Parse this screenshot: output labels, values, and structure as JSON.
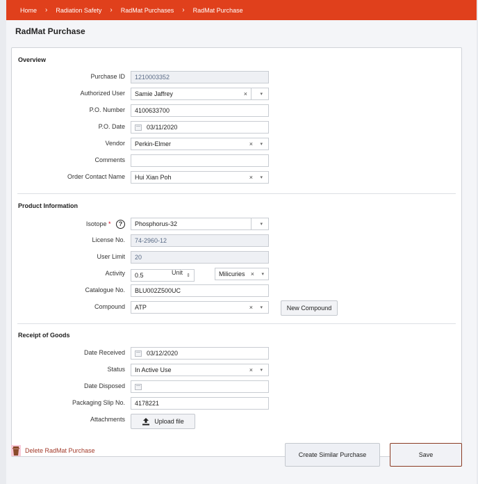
{
  "breadcrumb": [
    "Home",
    "Radiation Safety",
    "RadMat Purchases",
    "RadMat Purchase"
  ],
  "page_title": "RadMat Purchase",
  "overview": {
    "title": "Overview",
    "purchase_id_label": "Purchase ID",
    "purchase_id": "1210003352",
    "authorized_user_label": "Authorized User",
    "authorized_user": "Samie Jaffrey",
    "po_number_label": "P.O. Number",
    "po_number": "4100633700",
    "po_date_label": "P.O. Date",
    "po_date": "03/11/2020",
    "vendor_label": "Vendor",
    "vendor": "Perkin-Elmer",
    "comments_label": "Comments",
    "comments": "",
    "order_contact_label": "Order Contact Name",
    "order_contact": "Hui Xian Poh"
  },
  "product": {
    "title": "Product Information",
    "isotope_label": "Isotope",
    "required_mark": "*",
    "help_glyph": "?",
    "isotope": "Phosphorus-32",
    "license_label": "License No.",
    "license": "74-2960-12",
    "user_limit_label": "User Limit",
    "user_limit": "20",
    "activity_label": "Activity",
    "activity": "0.5",
    "unit_label": "Unit",
    "unit": "Milicuries",
    "catalogue_label": "Catalogue No.",
    "catalogue": "BLU002Z500UC",
    "compound_label": "Compound",
    "compound": "ATP",
    "new_compound_button": "New Compound"
  },
  "receipt": {
    "title": "Receipt of Goods",
    "date_received_label": "Date Received",
    "date_received": "03/12/2020",
    "status_label": "Status",
    "status": "In Active Use",
    "date_disposed_label": "Date Disposed",
    "date_disposed": "",
    "packaging_slip_label": "Packaging Slip No.",
    "packaging_slip": "4178221",
    "attachments_label": "Attachments",
    "upload_button": "Upload file"
  },
  "footer": {
    "delete_label": "Delete RadMat Purchase",
    "create_similar_label": "Create Similar Purchase",
    "save_label": "Save"
  },
  "colors": {
    "brand": "#e0401c",
    "delete": "#a23a2a",
    "save_border": "#8a3a22"
  },
  "icons": {
    "breadcrumb_separator": "chevron-right-icon",
    "clear": "×",
    "caret": "▾",
    "spinner": "⇕"
  }
}
